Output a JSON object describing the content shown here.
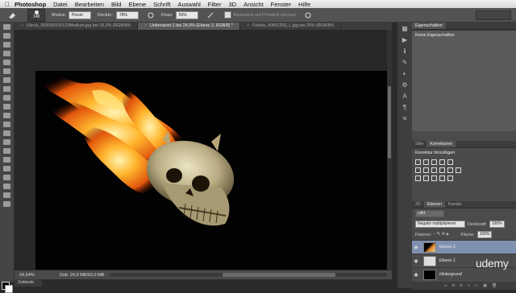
{
  "menubar": {
    "app": "Photoshop",
    "items": [
      "Datei",
      "Bearbeiten",
      "Bild",
      "Ebene",
      "Schrift",
      "Auswahl",
      "Filter",
      "3D",
      "Ansicht",
      "Fenster",
      "Hilfe"
    ]
  },
  "options": {
    "brush_size": "148",
    "modus_label": "Modus:",
    "modus_value": "Pinsel",
    "deckkraft_label": "Deckkr.:",
    "deckkraft_value": "78%",
    "fluss_label": "Fluss:",
    "fluss_value": "59%",
    "protocol_label": "Basierend auf Protokoll löschen"
  },
  "tabs": [
    {
      "label": "iStock_000000105133Medium.jpg bei 33,3% (RGB/8#)",
      "active": false
    },
    {
      "label": "Unbenannt-1 bei 24,9% (Ebene 2, RGB/8) *",
      "active": true
    },
    {
      "label": "Fotolia_40681293_L.jpg bei 25% (RGB/8#)",
      "active": false
    }
  ],
  "status": {
    "zoom": "24,94%",
    "doc": "Dok: 24,9 MB/63,0 MB",
    "bottom_tab": "Zeitleiste"
  },
  "properties": {
    "title": "Eigenschaften",
    "content": "Keine Eigenschaften"
  },
  "adjustments": {
    "tabs": [
      "Stile",
      "Korrekturen"
    ],
    "active_tab": "Korrekturen",
    "title": "Korrektur hinzufügen"
  },
  "layers": {
    "tabs": [
      "3D",
      "Ebenen",
      "Kanäle"
    ],
    "active_tab": "Ebenen",
    "filter": "Art",
    "blend_mode": "Negativ multiplizieren",
    "opacity_label": "Deckkraft:",
    "opacity_value": "100%",
    "fix_label": "Fixieren:",
    "fill_label": "Fläche:",
    "fill_value": "100%",
    "items": [
      {
        "name": "Ebene 2",
        "selected": true
      },
      {
        "name": "Ebene 1",
        "selected": false
      },
      {
        "name": "Hintergrund",
        "selected": false
      }
    ]
  },
  "watermark": "udemy",
  "colors": {
    "accent_selected_layer": "#8090b0",
    "ui_dark": "#2b2b2b",
    "ui_panel": "#4b4b4b"
  }
}
